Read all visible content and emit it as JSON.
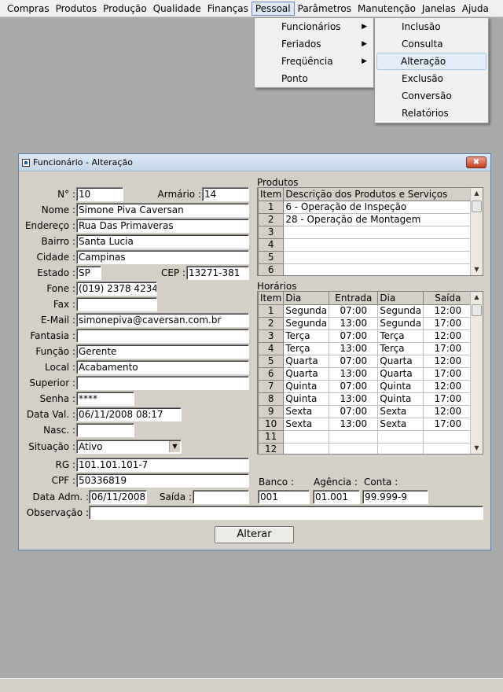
{
  "menu": [
    "Compras",
    "Produtos",
    "Produção",
    "Qualidade",
    "Finanças",
    "Pessoal",
    "Parâmetros",
    "Manutenção",
    "Janelas",
    "Ajuda"
  ],
  "submenu1": [
    "Funcionários",
    "Feriados",
    "Freqüência",
    "Ponto"
  ],
  "submenu2": [
    "Inclusão",
    "Consulta",
    "Alteração",
    "Exclusão",
    "Conversão",
    "Relatórios"
  ],
  "window": {
    "title": "Funcionário - Alteração"
  },
  "labels": {
    "numero": "N° :",
    "armario": "Armário :",
    "nome": "Nome :",
    "endereco": "Endereço :",
    "bairro": "Bairro :",
    "cidade": "Cidade :",
    "estado": "Estado :",
    "cep": "CEP :",
    "fone": "Fone :",
    "fax": "Fax :",
    "email": "E-Mail :",
    "fantasia": "Fantasia :",
    "funcao": "Função :",
    "local": "Local :",
    "superior": "Superior :",
    "senha": "Senha :",
    "data_val": "Data Val. :",
    "nasc": "Nasc. :",
    "situacao": "Situação :",
    "rg": "RG :",
    "cpf": "CPF :",
    "data_adm": "Data Adm. :",
    "saida": "Saída :",
    "banco": "Banco :",
    "agencia": "Agência :",
    "conta": "Conta :",
    "observacao": "Observação :",
    "produtos": "Produtos",
    "horarios": "Horários"
  },
  "values": {
    "numero": "10",
    "armario": "14",
    "nome": "Simone Piva Caversan",
    "endereco": "Rua Das Primaveras",
    "bairro": "Santa Lucia",
    "cidade": "Campinas",
    "estado": "SP",
    "cep": "13271-381",
    "fone": "(019) 2378 4234",
    "fax": "",
    "email": "simonepiva@caversan.com.br",
    "fantasia": "",
    "funcao": "Gerente",
    "local": "Acabamento",
    "superior": "",
    "senha": "****",
    "data_val": "06/11/2008 08:17",
    "nasc": "",
    "situacao": "Ativo",
    "rg": "101.101.101-7",
    "cpf": "50336819",
    "data_adm": "06/11/2008",
    "saida": "",
    "banco": "001",
    "agencia": "01.001",
    "conta": "99.999-9",
    "observacao": ""
  },
  "produtos": {
    "headers": [
      "Item",
      "Descrição dos Produtos e Serviços"
    ],
    "rows": [
      [
        "1",
        "6 - Operação de Inspeção"
      ],
      [
        "2",
        "28 - Operação de Montagem"
      ],
      [
        "3",
        ""
      ],
      [
        "4",
        ""
      ],
      [
        "5",
        ""
      ],
      [
        "6",
        ""
      ]
    ]
  },
  "horarios": {
    "headers": [
      "Item",
      "Dia",
      "Entrada",
      "Dia",
      "Saída"
    ],
    "rows": [
      [
        "1",
        "Segunda",
        "07:00",
        "Segunda",
        "12:00"
      ],
      [
        "2",
        "Segunda",
        "13:00",
        "Segunda",
        "17:00"
      ],
      [
        "3",
        "Terça",
        "07:00",
        "Terça",
        "12:00"
      ],
      [
        "4",
        "Terça",
        "13:00",
        "Terça",
        "17:00"
      ],
      [
        "5",
        "Quarta",
        "07:00",
        "Quarta",
        "12:00"
      ],
      [
        "6",
        "Quarta",
        "13:00",
        "Quarta",
        "17:00"
      ],
      [
        "7",
        "Quinta",
        "07:00",
        "Quinta",
        "12:00"
      ],
      [
        "8",
        "Quinta",
        "13:00",
        "Quinta",
        "17:00"
      ],
      [
        "9",
        "Sexta",
        "07:00",
        "Sexta",
        "12:00"
      ],
      [
        "10",
        "Sexta",
        "13:00",
        "Sexta",
        "17:00"
      ],
      [
        "11",
        "",
        "",
        "",
        ""
      ],
      [
        "12",
        "",
        "",
        "",
        ""
      ]
    ]
  },
  "button": {
    "alterar": "Alterar"
  }
}
